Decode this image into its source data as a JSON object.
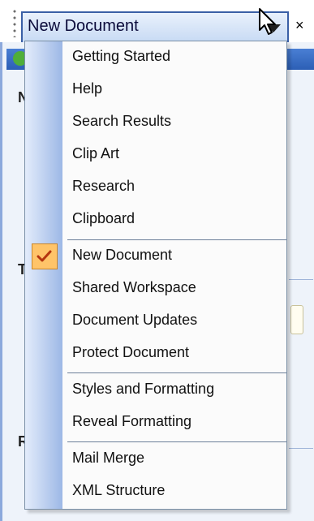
{
  "title_bar": {
    "title": "New Document",
    "close_glyph": "×"
  },
  "pane": {
    "letters": [
      "N",
      "T",
      "R"
    ]
  },
  "menu": {
    "items": [
      {
        "label": "Getting Started",
        "checked": false
      },
      {
        "label": "Help",
        "checked": false
      },
      {
        "label": "Search Results",
        "checked": false
      },
      {
        "label": "Clip Art",
        "checked": false
      },
      {
        "label": "Research",
        "checked": false
      },
      {
        "label": "Clipboard",
        "checked": false
      },
      {
        "label": "New Document",
        "checked": true
      },
      {
        "label": "Shared Workspace",
        "checked": false
      },
      {
        "label": "Document Updates",
        "checked": false
      },
      {
        "label": "Protect Document",
        "checked": false
      },
      {
        "label": "Styles and Formatting",
        "checked": false
      },
      {
        "label": "Reveal Formatting",
        "checked": false
      },
      {
        "label": "Mail Merge",
        "checked": false
      },
      {
        "label": "XML Structure",
        "checked": false
      }
    ],
    "check_glyph": "✓"
  },
  "colors": {
    "accent": "#3a5fa6",
    "check_highlight": "#ffc469",
    "check_mark": "#b5360f"
  }
}
